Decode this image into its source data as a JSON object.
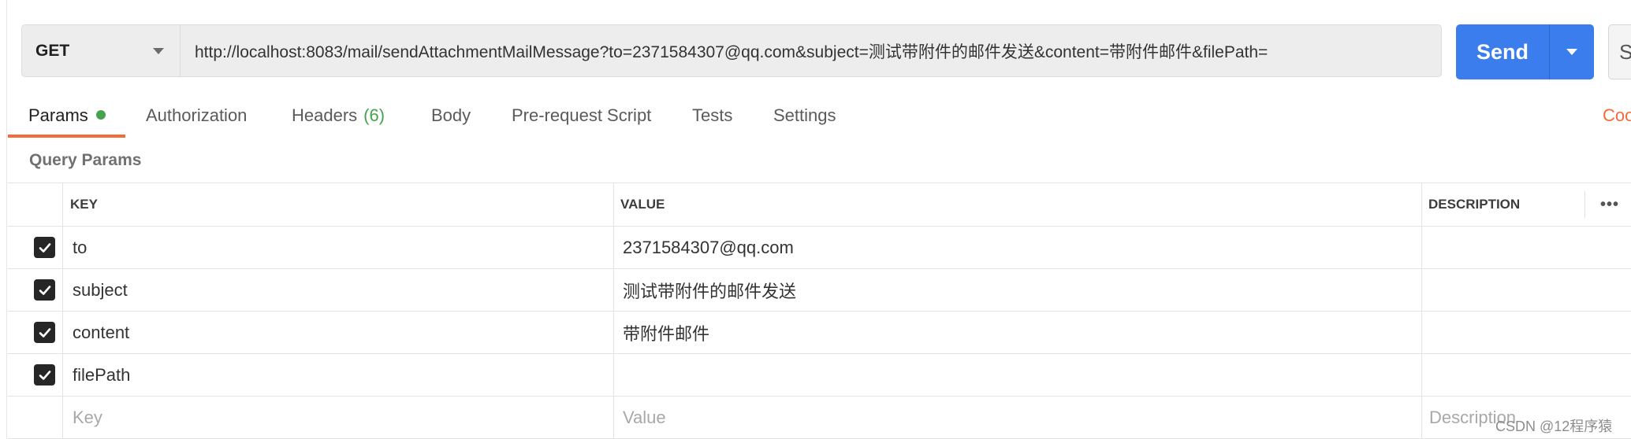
{
  "request": {
    "method": "GET",
    "url": "http://localhost:8083/mail/sendAttachmentMailMessage?to=2371584307@qq.com&subject=测试带附件的邮件发送&content=带附件邮件&filePath=",
    "send_label": "Send",
    "save_partial": "S"
  },
  "tabs": [
    {
      "label": "Params",
      "active": true
    },
    {
      "label": "Authorization"
    },
    {
      "label": "Headers",
      "count": "(6)"
    },
    {
      "label": "Body"
    },
    {
      "label": "Pre-request Script"
    },
    {
      "label": "Tests"
    },
    {
      "label": "Settings"
    }
  ],
  "cookies_label": "Coo",
  "query_params": {
    "title": "Query Params",
    "columns": {
      "key": "KEY",
      "value": "VALUE",
      "description": "DESCRIPTION"
    },
    "rows": [
      {
        "key": "to",
        "value": "2371584307@qq.com",
        "checked": true
      },
      {
        "key": "subject",
        "value": "测试带附件的邮件发送",
        "checked": true
      },
      {
        "key": "content",
        "value": "带附件邮件",
        "checked": true
      },
      {
        "key": "filePath",
        "value": "",
        "checked": true
      }
    ],
    "placeholders": {
      "key": "Key",
      "value": "Value",
      "description": "Description"
    },
    "more_label": "•••"
  },
  "watermark": "CSDN @12程序猿",
  "colors": {
    "accent": "#f26b3a",
    "send": "#3b7ded",
    "status_green": "#45a34d"
  }
}
